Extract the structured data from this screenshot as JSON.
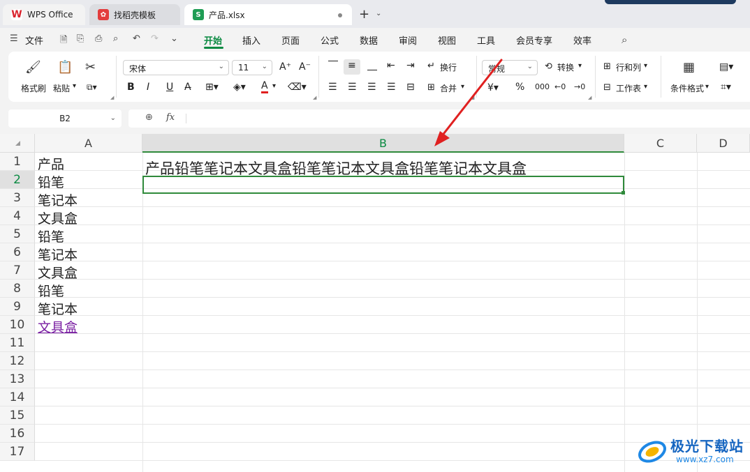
{
  "tabs": [
    {
      "label": "WPS Office",
      "icon": "wps-logo-icon",
      "color": "#d9232d"
    },
    {
      "label": "找稻壳模板",
      "icon": "docer-icon",
      "color": "#e33d3d"
    },
    {
      "label": "产品.xlsx",
      "icon": "spreadsheet-s-icon",
      "icon_letter": "S",
      "color": "#1f9d55"
    }
  ],
  "menu": {
    "file": "文件",
    "items": [
      "开始",
      "插入",
      "页面",
      "公式",
      "数据",
      "审阅",
      "视图",
      "工具",
      "会员专享",
      "效率"
    ],
    "active": "开始"
  },
  "ribbon": {
    "format_painter": "格式刷",
    "paste": "粘贴",
    "font_name": "宋体",
    "font_size": "11",
    "bold": "B",
    "italic": "I",
    "underline": "U",
    "wrap_text": "换行",
    "merge": "合并",
    "number_format": "常规",
    "convert": "转换",
    "percent": "%",
    "rows_cols": "行和列",
    "worksheet": "工作表",
    "conditional_format": "条件格式"
  },
  "formula_bar": {
    "name_box": "B2",
    "fx": "fx",
    "value": ""
  },
  "grid": {
    "columns": [
      "A",
      "B",
      "C",
      "D"
    ],
    "active_column": "B",
    "rows": [
      "1",
      "2",
      "3",
      "4",
      "5",
      "6",
      "7",
      "8",
      "9",
      "10",
      "11",
      "12",
      "13",
      "14",
      "15",
      "16",
      "17"
    ],
    "active_row": "2",
    "column_a": [
      "产品",
      "铅笔",
      "笔记本",
      "文具盒",
      "铅笔",
      "笔记本",
      "文具盒",
      "铅笔",
      "笔记本",
      "文具盒"
    ],
    "b1": "产品铅笔笔记本文具盒铅笔笔记本文具盒铅笔笔记本文具盒"
  },
  "watermark": {
    "name": "极光下载站",
    "url": "www.xz7.com"
  },
  "colors": {
    "accent": "#0b8a42",
    "selection": "#2f8a3b",
    "arrow": "#e02020"
  }
}
